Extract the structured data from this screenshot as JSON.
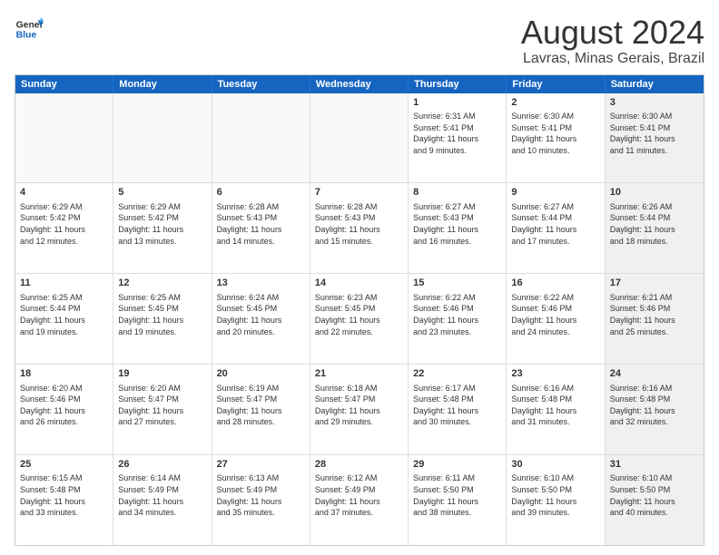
{
  "logo": {
    "line1": "General",
    "line2": "Blue"
  },
  "title": "August 2024",
  "subtitle": "Lavras, Minas Gerais, Brazil",
  "weekdays": [
    "Sunday",
    "Monday",
    "Tuesday",
    "Wednesday",
    "Thursday",
    "Friday",
    "Saturday"
  ],
  "rows": [
    [
      {
        "day": "",
        "info": "",
        "empty": true
      },
      {
        "day": "",
        "info": "",
        "empty": true
      },
      {
        "day": "",
        "info": "",
        "empty": true
      },
      {
        "day": "",
        "info": "",
        "empty": true
      },
      {
        "day": "1",
        "info": "Sunrise: 6:31 AM\nSunset: 5:41 PM\nDaylight: 11 hours\nand 9 minutes."
      },
      {
        "day": "2",
        "info": "Sunrise: 6:30 AM\nSunset: 5:41 PM\nDaylight: 11 hours\nand 10 minutes."
      },
      {
        "day": "3",
        "info": "Sunrise: 6:30 AM\nSunset: 5:41 PM\nDaylight: 11 hours\nand 11 minutes.",
        "shaded": true
      }
    ],
    [
      {
        "day": "4",
        "info": "Sunrise: 6:29 AM\nSunset: 5:42 PM\nDaylight: 11 hours\nand 12 minutes."
      },
      {
        "day": "5",
        "info": "Sunrise: 6:29 AM\nSunset: 5:42 PM\nDaylight: 11 hours\nand 13 minutes."
      },
      {
        "day": "6",
        "info": "Sunrise: 6:28 AM\nSunset: 5:43 PM\nDaylight: 11 hours\nand 14 minutes."
      },
      {
        "day": "7",
        "info": "Sunrise: 6:28 AM\nSunset: 5:43 PM\nDaylight: 11 hours\nand 15 minutes."
      },
      {
        "day": "8",
        "info": "Sunrise: 6:27 AM\nSunset: 5:43 PM\nDaylight: 11 hours\nand 16 minutes."
      },
      {
        "day": "9",
        "info": "Sunrise: 6:27 AM\nSunset: 5:44 PM\nDaylight: 11 hours\nand 17 minutes."
      },
      {
        "day": "10",
        "info": "Sunrise: 6:26 AM\nSunset: 5:44 PM\nDaylight: 11 hours\nand 18 minutes.",
        "shaded": true
      }
    ],
    [
      {
        "day": "11",
        "info": "Sunrise: 6:25 AM\nSunset: 5:44 PM\nDaylight: 11 hours\nand 19 minutes."
      },
      {
        "day": "12",
        "info": "Sunrise: 6:25 AM\nSunset: 5:45 PM\nDaylight: 11 hours\nand 19 minutes."
      },
      {
        "day": "13",
        "info": "Sunrise: 6:24 AM\nSunset: 5:45 PM\nDaylight: 11 hours\nand 20 minutes."
      },
      {
        "day": "14",
        "info": "Sunrise: 6:23 AM\nSunset: 5:45 PM\nDaylight: 11 hours\nand 22 minutes."
      },
      {
        "day": "15",
        "info": "Sunrise: 6:22 AM\nSunset: 5:46 PM\nDaylight: 11 hours\nand 23 minutes."
      },
      {
        "day": "16",
        "info": "Sunrise: 6:22 AM\nSunset: 5:46 PM\nDaylight: 11 hours\nand 24 minutes."
      },
      {
        "day": "17",
        "info": "Sunrise: 6:21 AM\nSunset: 5:46 PM\nDaylight: 11 hours\nand 25 minutes.",
        "shaded": true
      }
    ],
    [
      {
        "day": "18",
        "info": "Sunrise: 6:20 AM\nSunset: 5:46 PM\nDaylight: 11 hours\nand 26 minutes."
      },
      {
        "day": "19",
        "info": "Sunrise: 6:20 AM\nSunset: 5:47 PM\nDaylight: 11 hours\nand 27 minutes."
      },
      {
        "day": "20",
        "info": "Sunrise: 6:19 AM\nSunset: 5:47 PM\nDaylight: 11 hours\nand 28 minutes."
      },
      {
        "day": "21",
        "info": "Sunrise: 6:18 AM\nSunset: 5:47 PM\nDaylight: 11 hours\nand 29 minutes."
      },
      {
        "day": "22",
        "info": "Sunrise: 6:17 AM\nSunset: 5:48 PM\nDaylight: 11 hours\nand 30 minutes."
      },
      {
        "day": "23",
        "info": "Sunrise: 6:16 AM\nSunset: 5:48 PM\nDaylight: 11 hours\nand 31 minutes."
      },
      {
        "day": "24",
        "info": "Sunrise: 6:16 AM\nSunset: 5:48 PM\nDaylight: 11 hours\nand 32 minutes.",
        "shaded": true
      }
    ],
    [
      {
        "day": "25",
        "info": "Sunrise: 6:15 AM\nSunset: 5:48 PM\nDaylight: 11 hours\nand 33 minutes."
      },
      {
        "day": "26",
        "info": "Sunrise: 6:14 AM\nSunset: 5:49 PM\nDaylight: 11 hours\nand 34 minutes."
      },
      {
        "day": "27",
        "info": "Sunrise: 6:13 AM\nSunset: 5:49 PM\nDaylight: 11 hours\nand 35 minutes."
      },
      {
        "day": "28",
        "info": "Sunrise: 6:12 AM\nSunset: 5:49 PM\nDaylight: 11 hours\nand 37 minutes."
      },
      {
        "day": "29",
        "info": "Sunrise: 6:11 AM\nSunset: 5:50 PM\nDaylight: 11 hours\nand 38 minutes."
      },
      {
        "day": "30",
        "info": "Sunrise: 6:10 AM\nSunset: 5:50 PM\nDaylight: 11 hours\nand 39 minutes."
      },
      {
        "day": "31",
        "info": "Sunrise: 6:10 AM\nSunset: 5:50 PM\nDaylight: 11 hours\nand 40 minutes.",
        "shaded": true
      }
    ]
  ]
}
